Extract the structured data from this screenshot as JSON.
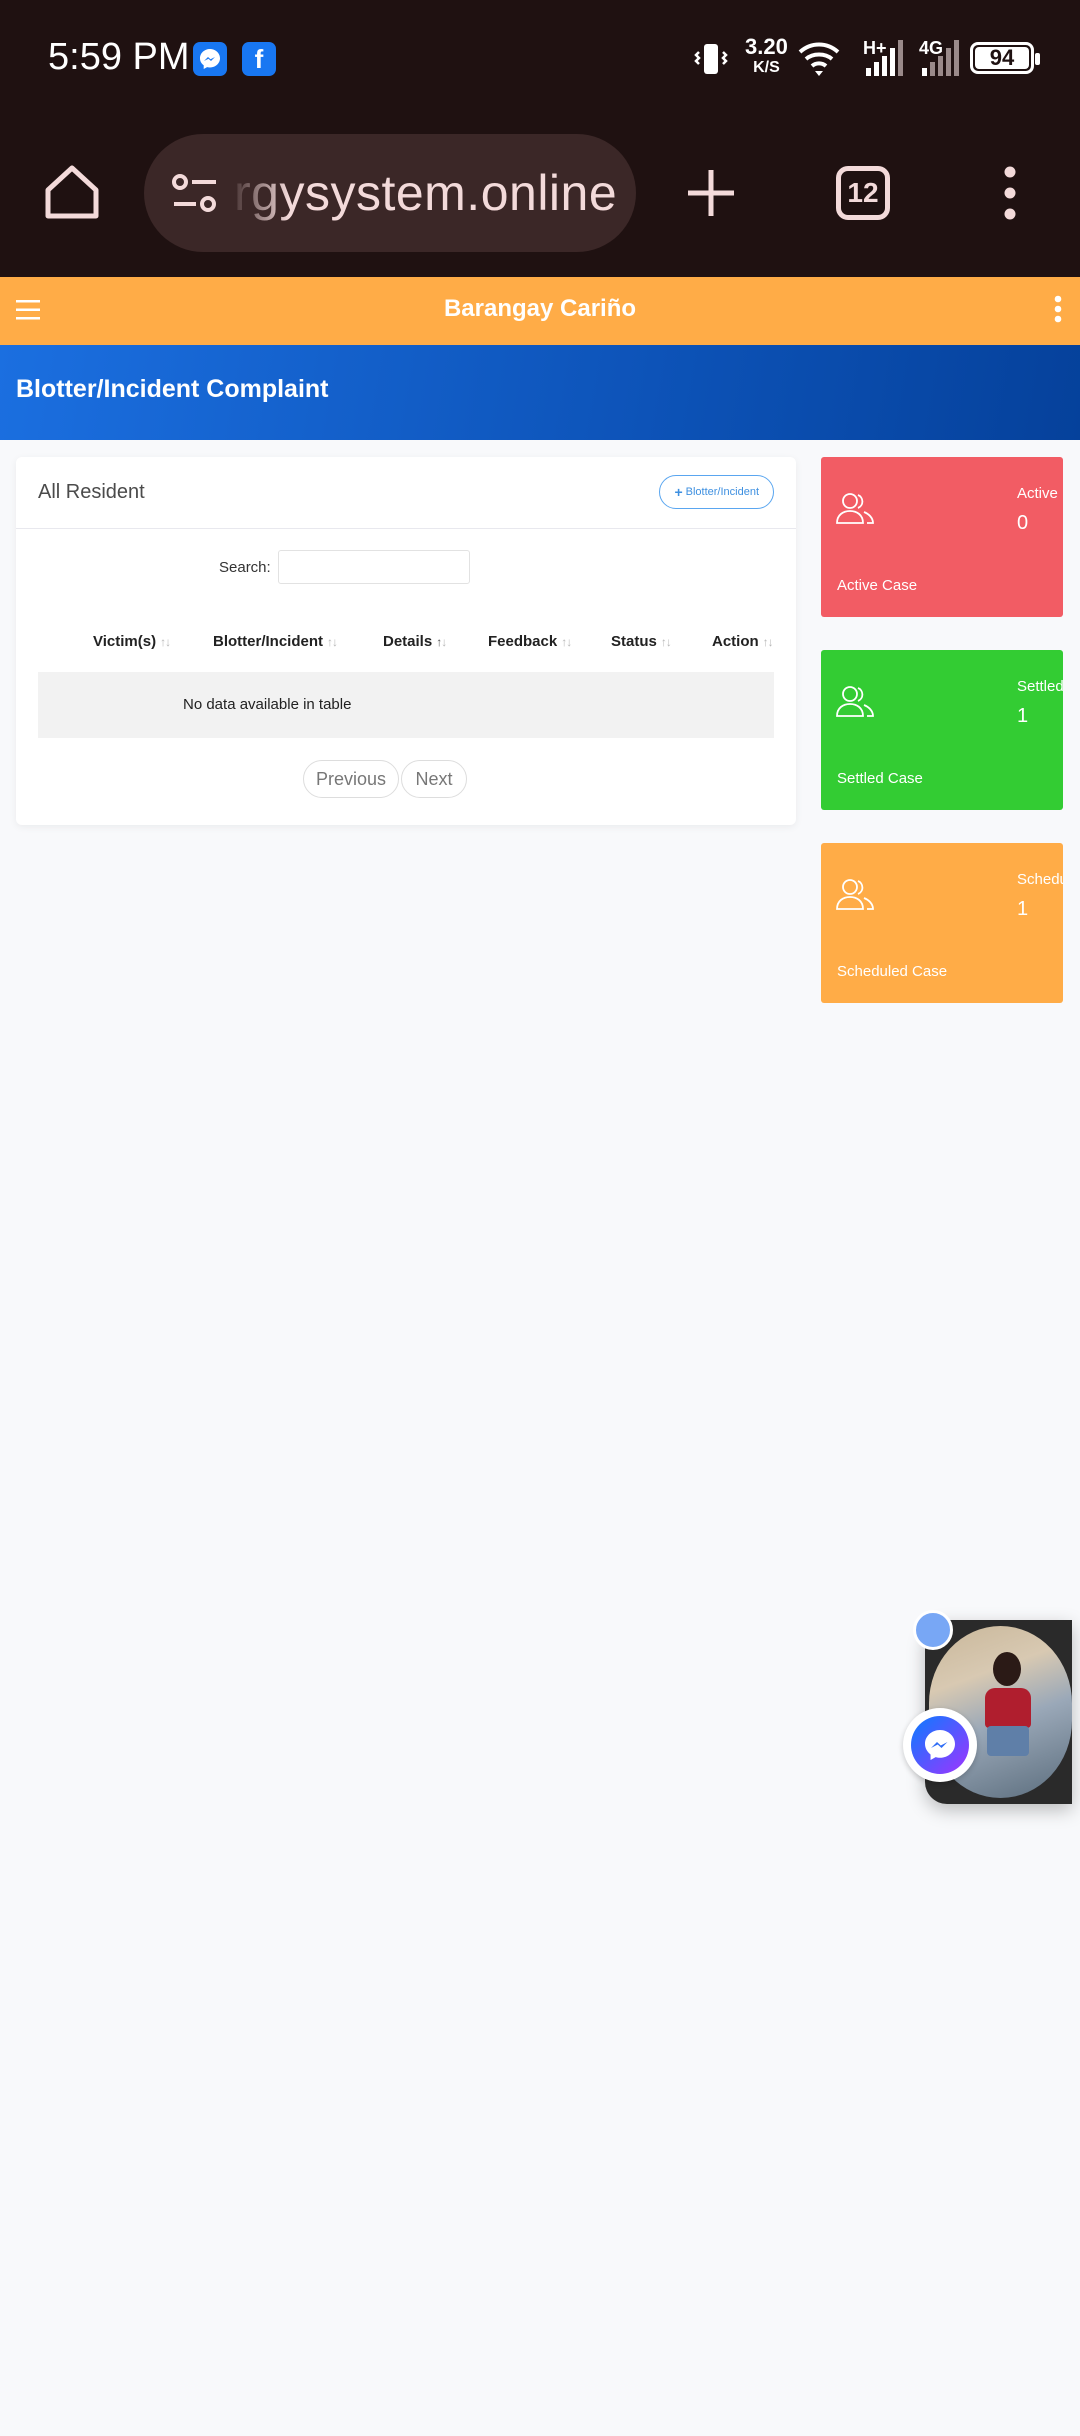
{
  "status_bar": {
    "time": "5:59 PM",
    "net_speed": "3.20",
    "net_speed_unit": "K/S",
    "signal_a": "H+",
    "signal_b": "4G",
    "battery": "94"
  },
  "browser": {
    "url": "rgysystem.online",
    "tab_count": "12"
  },
  "navbar": {
    "brand": "Barangay Cariño",
    "accent": "#ffac47"
  },
  "page_header": {
    "title": "Blotter/Incident Complaint"
  },
  "card": {
    "title": "All Resident",
    "add_button": "Blotter/Incident",
    "search_label": "Search:",
    "search_value": "",
    "columns": [
      "Victim(s)",
      "Blotter/Incident",
      "Details",
      "Feedback",
      "Status",
      "Action"
    ],
    "empty_message": "No data available in table",
    "prev_label": "Previous",
    "next_label": "Next"
  },
  "stats": [
    {
      "label": "Active",
      "value": "0",
      "footer": "Active Case",
      "color": "#f25c64"
    },
    {
      "label": "Settled",
      "value": "1",
      "footer": "Settled Case",
      "color": "#33cc33"
    },
    {
      "label": "Schedu",
      "value": "1",
      "footer": "Scheduled Case",
      "color": "#ffac47"
    }
  ]
}
